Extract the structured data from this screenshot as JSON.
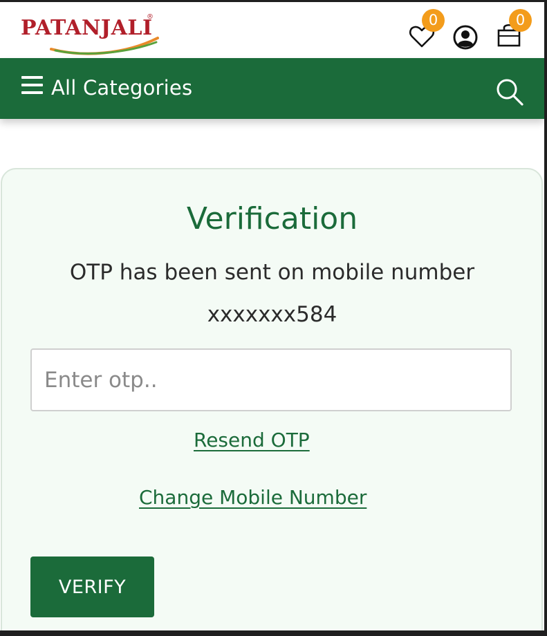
{
  "header": {
    "logo_text": "PATANJALI",
    "logo_registered": "®",
    "wishlist_count": "0",
    "cart_count": "0"
  },
  "nav": {
    "categories_label": "All Categories"
  },
  "verification": {
    "title": "Verification",
    "message": "OTP has been sent on mobile number",
    "masked_number": "xxxxxxx584",
    "otp_placeholder": "Enter otp..",
    "otp_value": "",
    "resend_label": "Resend OTP",
    "change_number_label": "Change Mobile Number",
    "verify_label": "VERIFY"
  },
  "colors": {
    "brand_green": "#1b6b3a",
    "badge_orange": "#f39c1b",
    "logo_red": "#b11f2a",
    "card_bg": "#f4fbf5"
  },
  "icons": {
    "menu": "hamburger-menu-icon",
    "search": "search-icon",
    "wishlist": "heart-icon",
    "account": "user-account-icon",
    "cart": "shopping-bag-icon"
  }
}
